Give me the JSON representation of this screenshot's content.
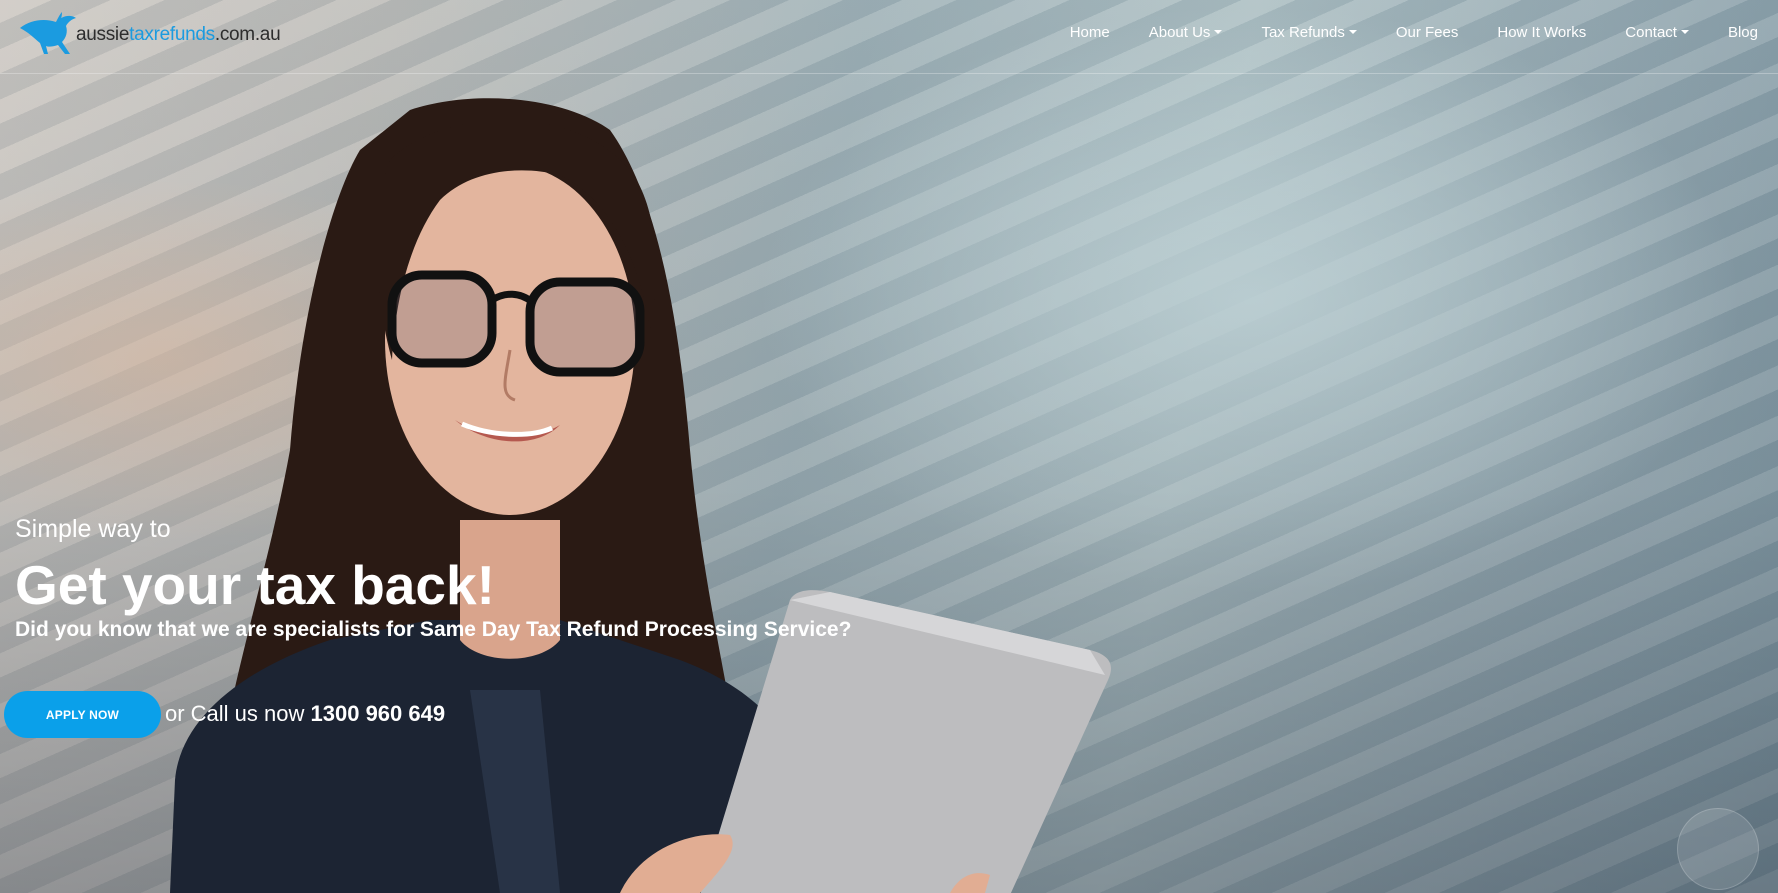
{
  "logo": {
    "part_aussie": "aussie",
    "part_taxrefunds": "taxrefunds",
    "part_domain": ".com.au",
    "brand_color": "#1b9be0"
  },
  "nav": {
    "items": [
      {
        "label": "Home",
        "has_dropdown": false
      },
      {
        "label": "About Us",
        "has_dropdown": true
      },
      {
        "label": "Tax Refunds",
        "has_dropdown": true
      },
      {
        "label": "Our Fees",
        "has_dropdown": false
      },
      {
        "label": "How It Works",
        "has_dropdown": false
      },
      {
        "label": "Contact",
        "has_dropdown": true
      },
      {
        "label": "Blog",
        "has_dropdown": false
      }
    ]
  },
  "hero": {
    "pre_title": "Simple way to",
    "headline": "Get your tax back!",
    "subline": "Did you know that we are specialists for Same Day Tax Refund Processing Service?",
    "apply_label": "APPLY NOW",
    "call_text": "or Call us now",
    "phone": "1300 960 649",
    "accent_color": "#0aa0ea"
  }
}
